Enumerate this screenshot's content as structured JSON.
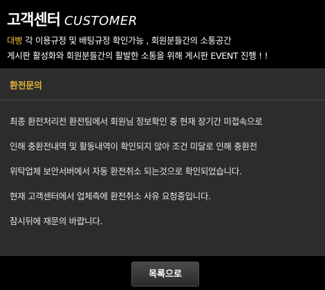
{
  "header": {
    "title_ko": "고객센터",
    "title_en": "CUSTOMER",
    "notice_brand": "대빵",
    "notice_line1_rest": " 각 이용규정 및 배팅규정 확인가능 , 회원분들간의 소통공간",
    "notice_line2": "게시판 활성화와 회원분들간의 활발한 소통을 위해 게시판 EVENT 진행 ! !"
  },
  "post": {
    "title": "환전문의",
    "body_lines": [
      "최종 환전처리전 환전팀에서 회원님 정보확인 중 현재 장기간 미접속으로",
      "인해 충환전내역 및 활동내역이 확인되지 않아 조건 미달로 인해 충환전",
      "위탁업체 보안서버에서 자동 환전취소 되는것으로 확인되었습니다.",
      "현재 고객센터에서 업체측에 환전취소 사유 요청중입니다.",
      "잠시뒤에 재문의 바랍니다."
    ]
  },
  "footer": {
    "list_button_label": "목록으로"
  },
  "colors": {
    "accent": "#e8b53a",
    "panel_bg": "#2c2c2c",
    "page_bg": "#000000"
  }
}
